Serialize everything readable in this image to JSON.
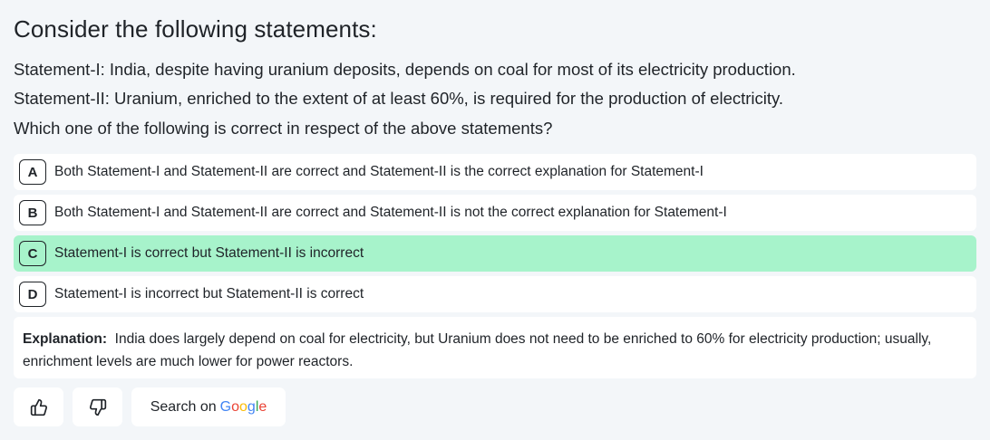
{
  "question": {
    "title": "Consider the following statements:",
    "statement1": "Statement-I: India, despite having uranium deposits, depends on coal for most of its electricity production.",
    "statement2": "Statement-II: Uranium, enriched to the extent of at least 60%, is required for the production of electricity.",
    "prompt": "Which one of the following is correct in respect of the above statements?"
  },
  "options": [
    {
      "letter": "A",
      "text": "Both Statement-I and Statement-II are correct and Statement-II is the correct explanation for Statement-I"
    },
    {
      "letter": "B",
      "text": "Both Statement-I and Statement-II are correct and Statement-II is not the correct explanation for Statement-I"
    },
    {
      "letter": "C",
      "text": "Statement-I is correct but Statement-II is incorrect",
      "correct": true
    },
    {
      "letter": "D",
      "text": "Statement-I is incorrect but Statement-II is correct"
    }
  ],
  "explanation": {
    "label": "Explanation:",
    "text": "India does largely depend on coal for electricity, but Uranium does not need to be enriched to 60% for electricity production; usually, enrichment levels are much lower for power reactors."
  },
  "actions": {
    "like_icon": "thumbs-up-icon",
    "dislike_icon": "thumbs-down-icon",
    "search_prefix": "Search on",
    "search_brand": [
      "G",
      "o",
      "o",
      "g",
      "l",
      "e"
    ]
  },
  "colors": {
    "background": "#f3f6f9",
    "correct_option": "#a7f3cb",
    "card": "#ffffff"
  }
}
